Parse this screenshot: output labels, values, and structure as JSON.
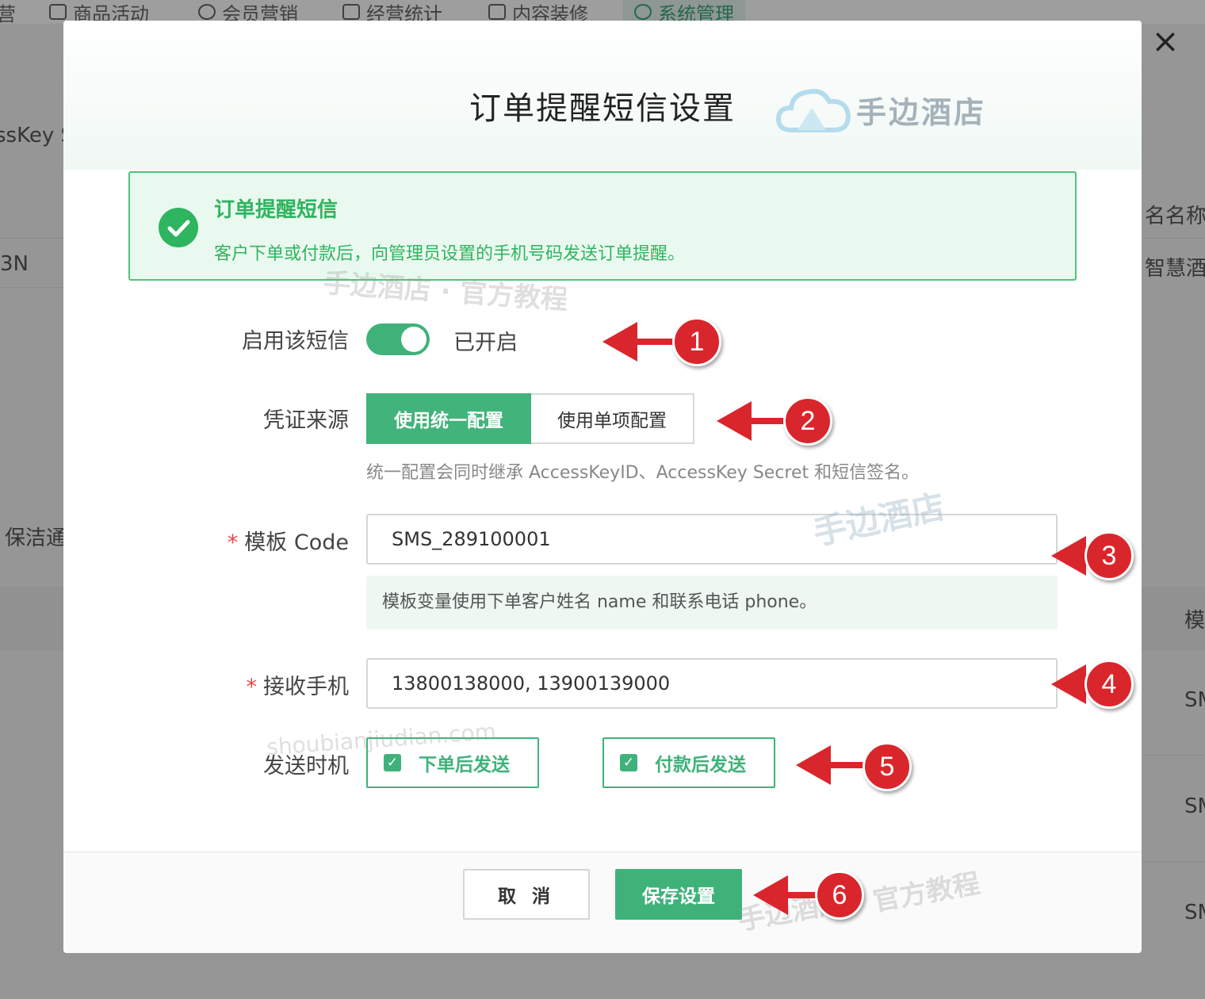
{
  "background": {
    "nav_tabs": [
      "营",
      "商品活动",
      "会员营销",
      "经营统计",
      "内容装修",
      "系统管理"
    ],
    "left_texts": [
      "ssKey S",
      "3N",
      "保洁通"
    ],
    "right_texts": [
      "名名称",
      "智慧酒",
      "模",
      "SM",
      "SM",
      "SM"
    ]
  },
  "modal": {
    "title": "订单提醒短信设置",
    "brand": "手边酒店",
    "close_icon": "×",
    "alert": {
      "title": "订单提醒短信",
      "description": "客户下单或付款后，向管理员设置的手机号码发送订单提醒。"
    },
    "enable": {
      "label": "启用该短信",
      "status": "已开启",
      "on": true
    },
    "credential": {
      "label": "凭证来源",
      "options": [
        "使用统一配置",
        "使用单项配置"
      ],
      "selected": "使用统一配置",
      "hint": "统一配置会同时继承 AccessKeyID、AccessKey Secret 和短信签名。"
    },
    "template": {
      "required_mark": "*",
      "label": "模板 Code",
      "value": "SMS_289100001",
      "tip": "模板变量使用下单客户姓名 name 和联系电话 phone。"
    },
    "phone": {
      "required_mark": "*",
      "label": "接收手机",
      "value": "13800138000, 13900139000"
    },
    "timing": {
      "label": "发送时机",
      "options": [
        "下单后发送",
        "付款后发送"
      ],
      "check_glyph": "✓"
    },
    "footer": {
      "cancel_label": "取 消",
      "save_label": "保存设置"
    }
  },
  "watermarks": [
    "手边酒店 · 官方教程",
    "手边酒店",
    "shoubianjiudian.com",
    "手边酒店",
    "官方教程"
  ],
  "markers": [
    "1",
    "2",
    "3",
    "4",
    "5",
    "6"
  ],
  "colors": {
    "primary_green": "#3fb27a",
    "alert_green": "#2fb45f",
    "required_red": "#e64545",
    "marker_red": "#d9262c"
  }
}
